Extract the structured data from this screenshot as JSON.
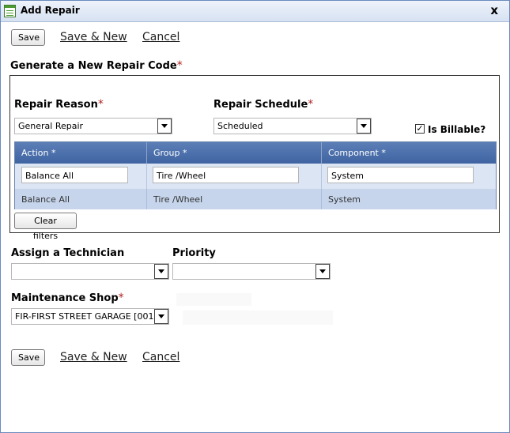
{
  "window": {
    "title": "Add Repair",
    "close_label": "x"
  },
  "toolbar_top": {
    "save_label": "Save",
    "save_new_label": "Save & New",
    "cancel_label": "Cancel"
  },
  "section": {
    "title": "Generate a New Repair Code",
    "required_mark": "*"
  },
  "repair_reason": {
    "label": "Repair Reason",
    "required_mark": "*",
    "value": "General Repair"
  },
  "repair_schedule": {
    "label": "Repair Schedule",
    "required_mark": "*",
    "value": "Scheduled"
  },
  "billable": {
    "label": "Is Billable?",
    "checked": true,
    "check_mark": "✓"
  },
  "grid": {
    "columns": [
      "Action *",
      "Group *",
      "Component *"
    ],
    "filters": [
      "Balance All",
      "Tire /Wheel",
      "System"
    ],
    "rows": [
      [
        "Balance All",
        "Tire /Wheel",
        "System"
      ]
    ]
  },
  "clear_filters_label": "Clear filters",
  "technician": {
    "label": "Assign a Technician",
    "value": ""
  },
  "priority": {
    "label": "Priority",
    "value": ""
  },
  "maintenance_shop": {
    "label": "Maintenance Shop",
    "required_mark": "*",
    "value": "FIR-FIRST STREET GARAGE [001]"
  },
  "toolbar_bottom": {
    "save_label": "Save",
    "save_new_label": "Save & New",
    "cancel_label": "Cancel"
  }
}
